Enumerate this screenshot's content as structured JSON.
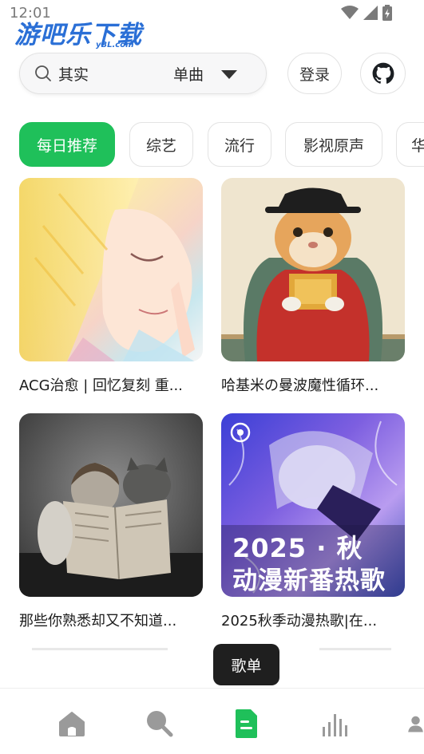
{
  "status_bar": {
    "time": "12:01"
  },
  "watermark": {
    "text": "游吧乐下载",
    "sub": "yBL.com"
  },
  "search": {
    "query": "其实",
    "type_selected": "单曲"
  },
  "header": {
    "login_label": "登录"
  },
  "categories": [
    "每日推荐",
    "综艺",
    "流行",
    "影视原声",
    "华"
  ],
  "playlists": [
    {
      "title": "ACG治愈 | 回忆复刻 重..."
    },
    {
      "title": "哈基米の曼波魔性循环..."
    },
    {
      "title": "那些你熟悉却又不知道..."
    },
    {
      "title": "2025秋季动漫热歌|在...",
      "cover_text_line1": "2025 · 秋",
      "cover_text_line2": "动漫新番热歌"
    }
  ],
  "toast": {
    "text": "歌单"
  },
  "bottom_nav": {
    "active": "playlist",
    "items": [
      "home-icon",
      "search-icon",
      "playlist-icon",
      "chart-icon",
      "profile-icon"
    ]
  },
  "colors": {
    "accent": "#1fc05a",
    "toast_bg": "#1f1f1f",
    "icon_inactive": "#9a9a9a"
  }
}
